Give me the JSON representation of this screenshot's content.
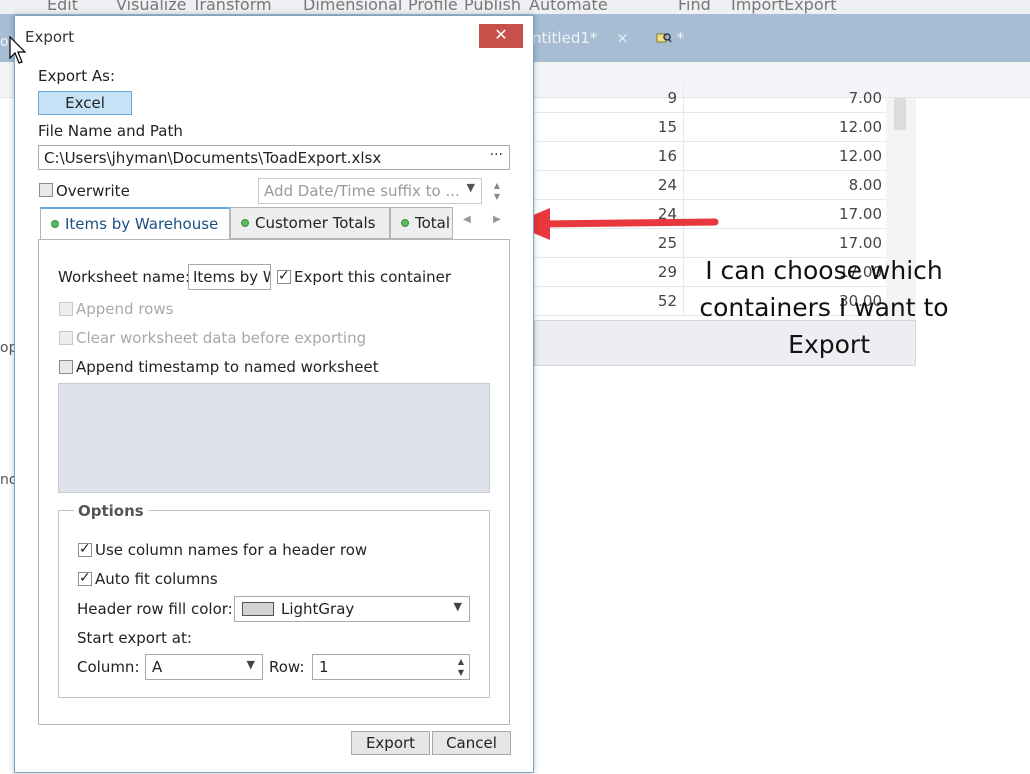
{
  "background_app": {
    "menu": [
      "Edit",
      "Visualize",
      "Transform",
      "Dimensional",
      "Profile",
      "Publish",
      "Automate",
      "Find",
      "ImportExport"
    ],
    "doc_tabs": [
      {
        "label": "ntitled1*",
        "close": "×"
      },
      {
        "label": "*",
        "close": ""
      }
    ],
    "left_fragments": [
      "o",
      "op",
      "no"
    ],
    "grid_rows": [
      {
        "a": "9",
        "b": "7.00"
      },
      {
        "a": "15",
        "b": "12.00"
      },
      {
        "a": "16",
        "b": "12.00"
      },
      {
        "a": "24",
        "b": "8.00"
      },
      {
        "a": "24",
        "b": "17.00"
      },
      {
        "a": "25",
        "b": "17.00"
      },
      {
        "a": "29",
        "b": "17.00"
      },
      {
        "a": "52",
        "b": "30.00"
      }
    ]
  },
  "annotation": {
    "line1": "I can choose which",
    "line2": "containers I want to",
    "line3": "Export",
    "arrow_color": "#e8383d"
  },
  "dialog": {
    "title": "Export",
    "close_label": "✕",
    "export_as_label": "Export As:",
    "export_as_value": "Excel",
    "file_label": "File Name and Path",
    "file_path": "C:\\Users\\jhyman\\Documents\\ToadExport.xlsx",
    "browse_label": "···",
    "overwrite_label": "Overwrite",
    "overwrite_checked": false,
    "suffix_placeholder": "Add Date/Time suffix to ...",
    "tabs": [
      {
        "label": "Items by Warehouse",
        "active": true
      },
      {
        "label": "Customer Totals",
        "active": false
      },
      {
        "label": "Total",
        "active": false
      }
    ],
    "worksheet_label": "Worksheet name:",
    "worksheet_value": "Items by Warehouse",
    "export_container_label": "Export this container",
    "export_container_checked": true,
    "append_rows_label": "Append rows",
    "clear_data_label": "Clear worksheet data before exporting",
    "append_timestamp_label": "Append timestamp to named worksheet",
    "options": {
      "title": "Options",
      "use_column_names_label": "Use column names for a header row",
      "use_column_names_checked": true,
      "auto_fit_label": "Auto fit columns",
      "auto_fit_checked": true,
      "fill_color_label": "Header row fill color:",
      "fill_color_value": "LightGray",
      "start_at_label": "Start export at:",
      "column_label": "Column:",
      "column_value": "A",
      "row_label": "Row:",
      "row_value": "1"
    },
    "export_button": "Export",
    "cancel_button": "Cancel"
  }
}
